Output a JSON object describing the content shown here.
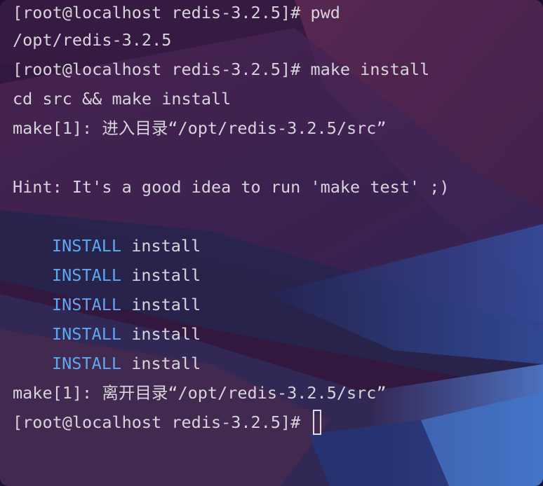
{
  "terminal": {
    "lines": {
      "l1": "[root@localhost redis-3.2.5]# pwd",
      "l2": "/opt/redis-3.2.5",
      "l3": "[root@localhost redis-3.2.5]# make install",
      "l4": "cd src && make install",
      "l5": "make[1]: 进入目录“/opt/redis-3.2.5/src”",
      "l6": "",
      "l7": "Hint: It's a good idea to run 'make test' ;)",
      "l8": "",
      "install_rows": [
        {
          "keyword": "INSTALL",
          "target": " install"
        },
        {
          "keyword": "INSTALL",
          "target": " install"
        },
        {
          "keyword": "INSTALL",
          "target": " install"
        },
        {
          "keyword": "INSTALL",
          "target": " install"
        },
        {
          "keyword": "INSTALL",
          "target": " install"
        }
      ],
      "l14": "make[1]: 离开目录“/opt/redis-3.2.5/src”",
      "prompt": "[root@localhost redis-3.2.5]# "
    }
  },
  "colors": {
    "text": "#d8d4dc",
    "install_keyword": "#5ea8f2"
  }
}
